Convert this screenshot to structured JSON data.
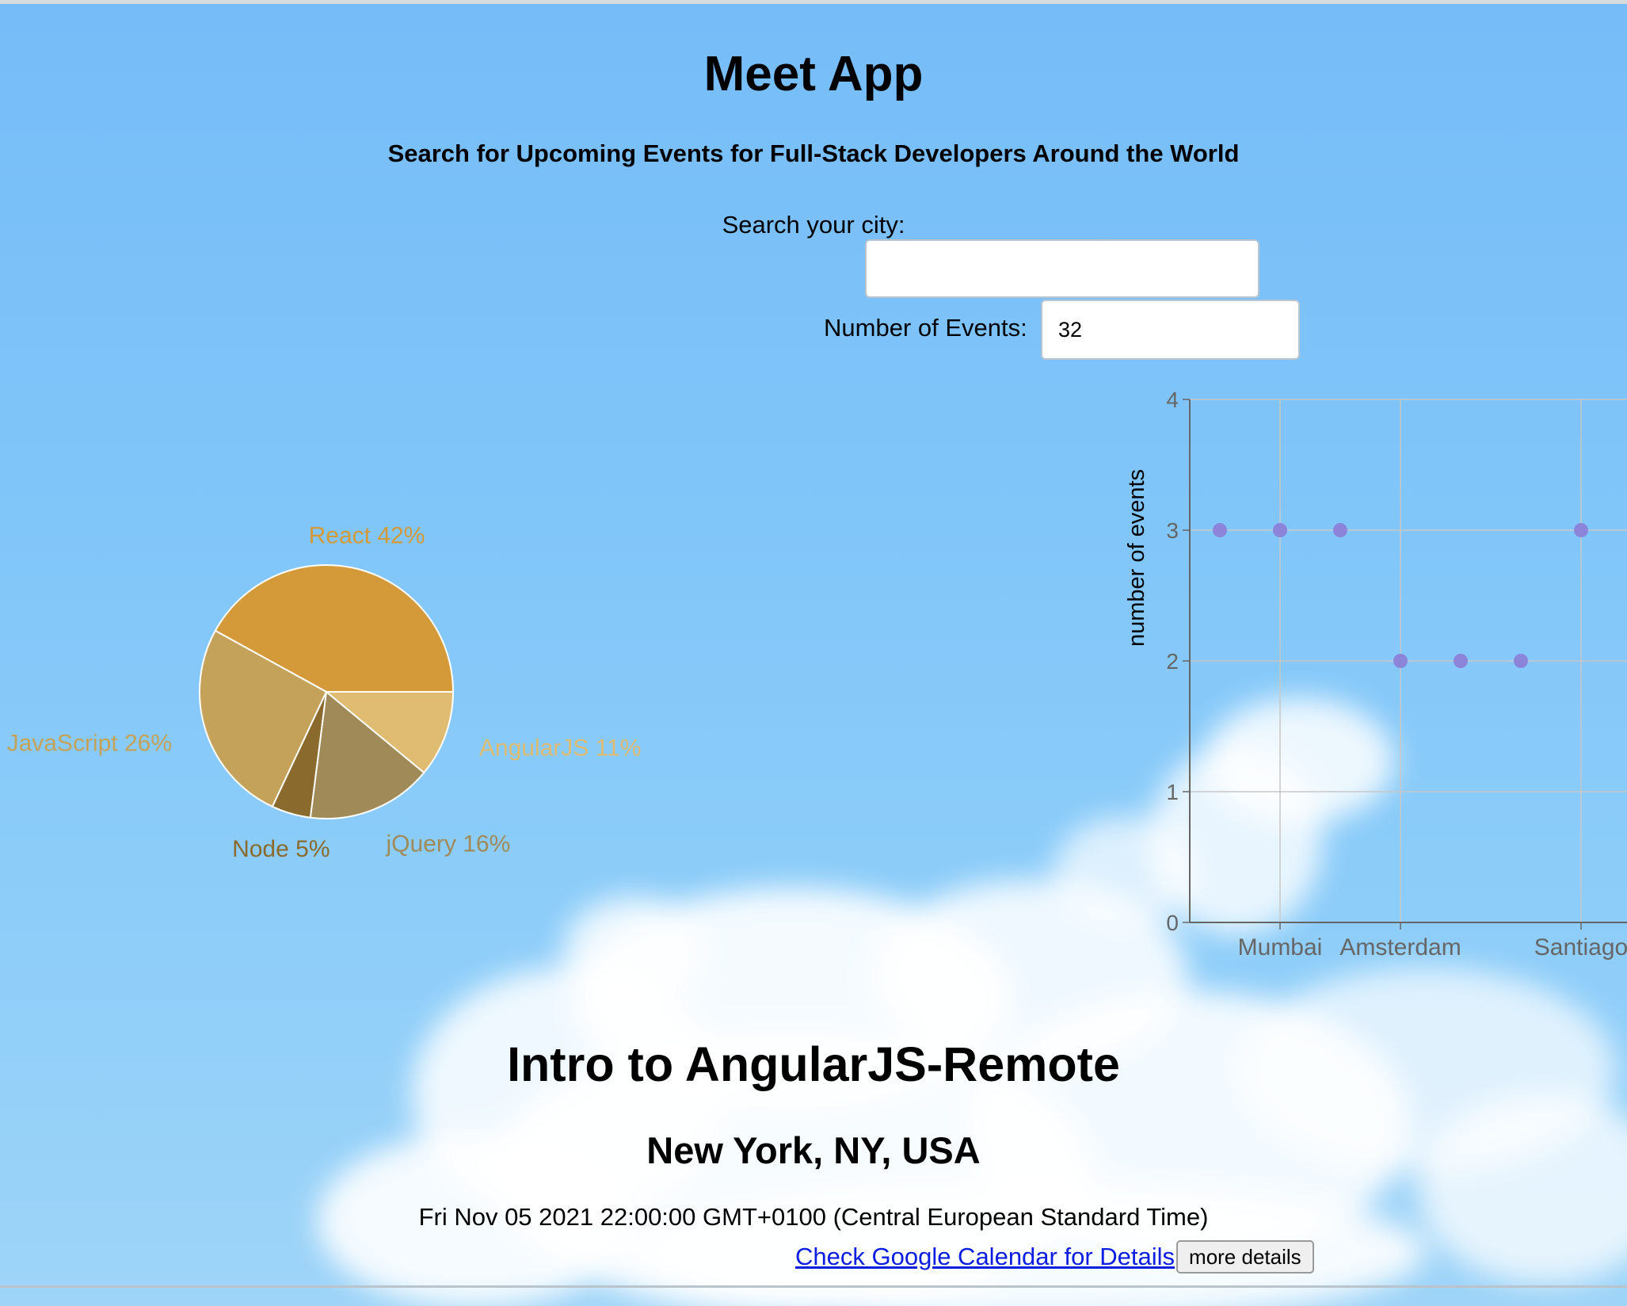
{
  "app": {
    "title": "Meet App",
    "subtitle": "Search for Upcoming Events for Full-Stack Developers Around the World"
  },
  "search": {
    "city_label": "Search your city:",
    "city_value": "",
    "events_label": "Number of Events:",
    "events_value": "32"
  },
  "pie_chart": {
    "type": "pie",
    "slices": [
      {
        "label": "React 42%",
        "value": 42,
        "color": "#d49a39"
      },
      {
        "label": "AngularJS 11%",
        "value": 11,
        "color": "#e0bb72"
      },
      {
        "label": "jQuery 16%",
        "value": 16,
        "color": "#a08a57"
      },
      {
        "label": "Node 5%",
        "value": 5,
        "color": "#8b6a2e"
      },
      {
        "label": "JavaScript 26%",
        "value": 26,
        "color": "#c4a25a"
      }
    ]
  },
  "chart_data": {
    "type": "scatter",
    "ylabel": "number of events",
    "xlabel": "",
    "ylim": [
      0,
      4
    ],
    "yticks": [
      "0",
      "1",
      "2",
      "3",
      "4"
    ],
    "categories": [
      "",
      "Mumbai",
      "",
      "Amsterdam",
      "",
      "",
      "Santiago"
    ],
    "values": [
      3,
      3,
      3,
      2,
      2,
      2,
      3
    ],
    "grid": true,
    "point_color": "#8c84d8"
  },
  "event": {
    "title": "Intro to AngularJS-Remote",
    "location": "New York, NY, USA",
    "time": "Fri Nov 05 2021 22:00:00 GMT+0100 (Central European Standard Time)",
    "calendar_link": "Check Google Calendar for Details",
    "details_button": "more details"
  }
}
